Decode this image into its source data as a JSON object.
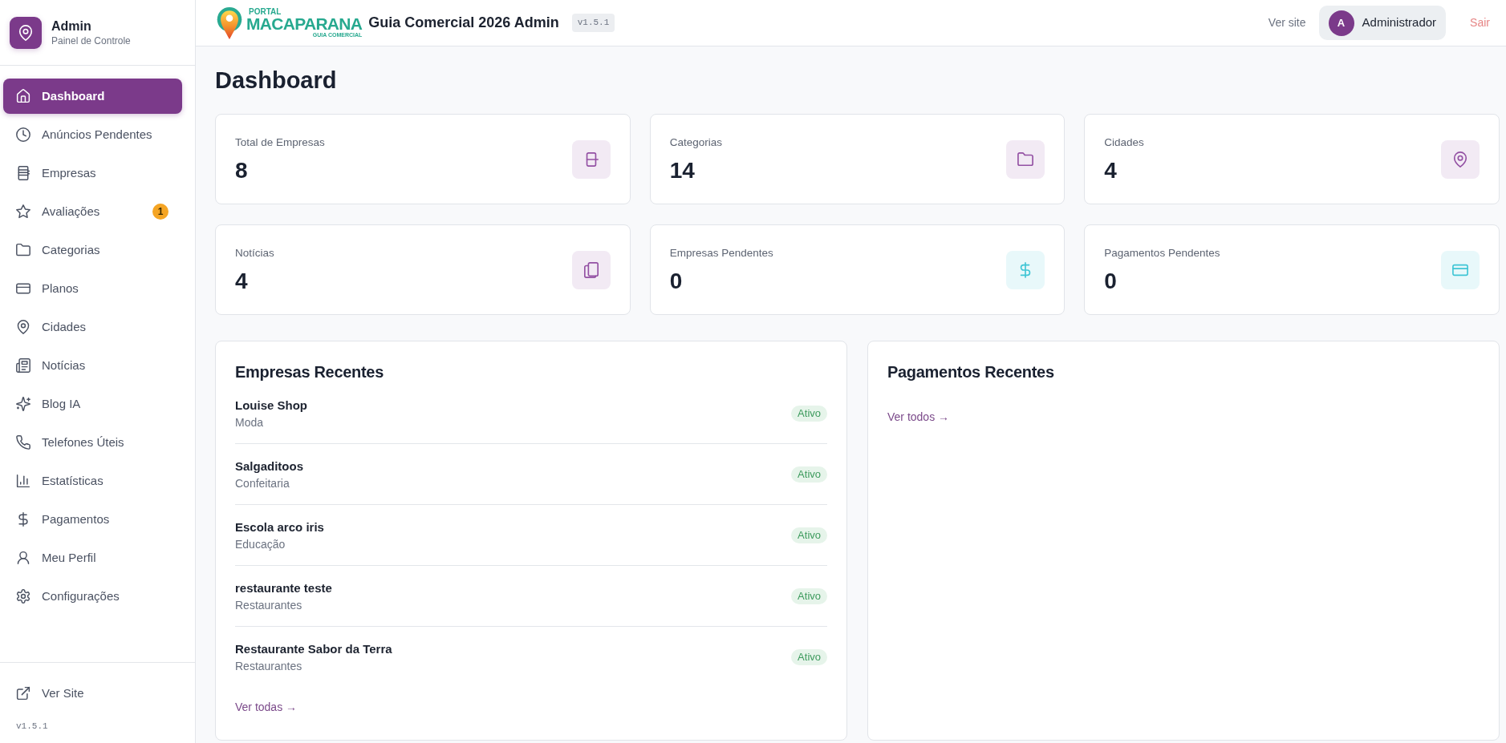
{
  "sidebar": {
    "brand": {
      "title": "Admin",
      "subtitle": "Painel de Controle"
    },
    "items": [
      {
        "label": "Dashboard",
        "selected": true
      },
      {
        "label": "Anúncios Pendentes",
        "selected": false
      },
      {
        "label": "Empresas",
        "selected": false
      },
      {
        "label": "Avaliações",
        "selected": false,
        "badge": "1"
      },
      {
        "label": "Categorias",
        "selected": false
      },
      {
        "label": "Planos",
        "selected": false
      },
      {
        "label": "Cidades",
        "selected": false
      },
      {
        "label": "Notícias",
        "selected": false
      },
      {
        "label": "Blog IA",
        "selected": false
      },
      {
        "label": "Telefones Úteis",
        "selected": false
      },
      {
        "label": "Estatísticas",
        "selected": false
      },
      {
        "label": "Pagamentos",
        "selected": false
      },
      {
        "label": "Meu Perfil",
        "selected": false
      },
      {
        "label": "Configurações",
        "selected": false
      }
    ],
    "footer": {
      "link": "Ver Site",
      "version": "v1.5.1"
    }
  },
  "header": {
    "logo": {
      "top": "PORTAL",
      "name": "MACAPARANA",
      "tagline": "GUIA COMERCIAL"
    },
    "title": "Guia Comercial 2026 Admin",
    "version": "v1.5.1",
    "view_site": "Ver site",
    "user": {
      "initial": "A",
      "name": "Administrador"
    },
    "logout": "Sair"
  },
  "page_title": "Dashboard",
  "stats": [
    {
      "label": "Total de Empresas",
      "value": "8",
      "color": "#f2eaf4"
    },
    {
      "label": "Categorias",
      "value": "14",
      "color": "#f2eaf4"
    },
    {
      "label": "Cidades",
      "value": "4",
      "color": "#f2eaf4"
    },
    {
      "label": "Notícias",
      "value": "4",
      "color": "#f2eaf4"
    },
    {
      "label": "Empresas Pendentes",
      "value": "0",
      "color": "#e8f8fa"
    },
    {
      "label": "Pagamentos Pendentes",
      "value": "0",
      "color": "#e8f8fa"
    }
  ],
  "recent_companies": {
    "title": "Empresas Recentes",
    "rows": [
      {
        "name": "Louise Shop",
        "category": "Moda",
        "status": "Ativo"
      },
      {
        "name": "Salgaditoos",
        "category": "Confeitaria",
        "status": "Ativo"
      },
      {
        "name": "Escola arco iris",
        "category": "Educação",
        "status": "Ativo"
      },
      {
        "name": "restaurante teste",
        "category": "Restaurantes",
        "status": "Ativo"
      },
      {
        "name": "Restaurante Sabor da Terra",
        "category": "Restaurantes",
        "status": "Ativo"
      }
    ],
    "link": "Ver todas →"
  },
  "recent_payments": {
    "title": "Pagamentos Recentes",
    "link": "Ver todos →"
  }
}
